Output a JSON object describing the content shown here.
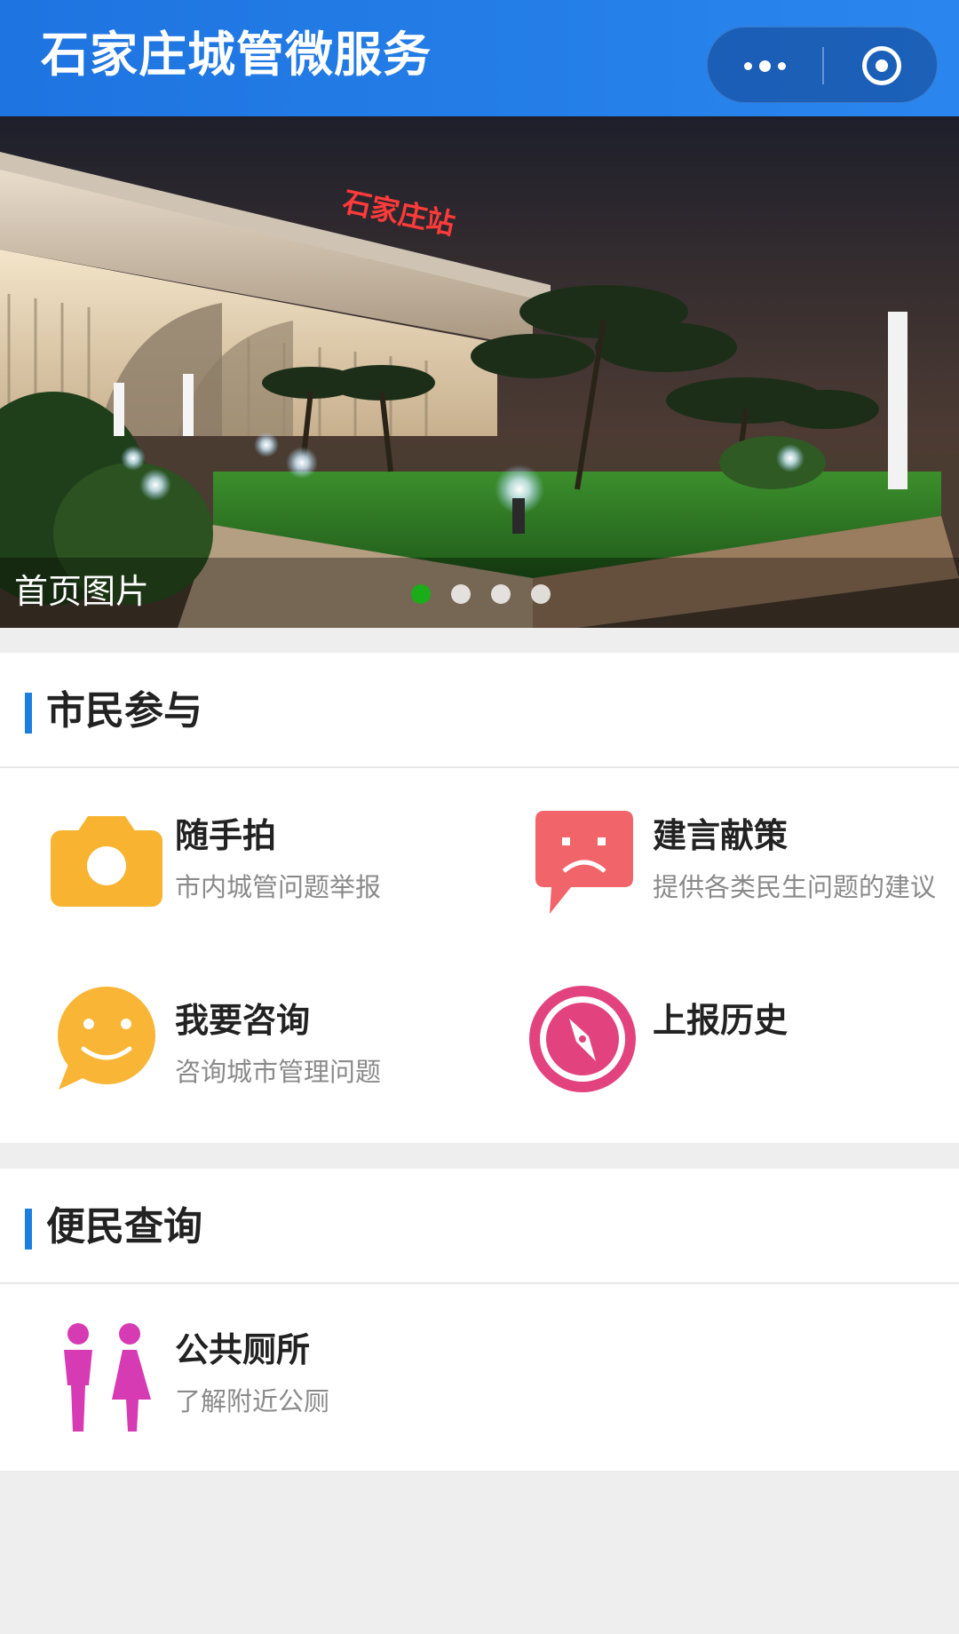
{
  "header": {
    "title": "石家庄城管微服务",
    "menu_icon": "more-dots-icon",
    "close_icon": "target-circle-icon"
  },
  "banner": {
    "caption": "首页图片",
    "sign_text": "石家庄站",
    "slide_count": 4,
    "active_slide": 1
  },
  "citizen": {
    "title": "市民参与",
    "items": [
      {
        "title": "随手拍",
        "desc": "市内城管问题举报",
        "icon": "camera-icon",
        "color": "#f8b431"
      },
      {
        "title": "建言献策",
        "desc": "提供各类民生问题的建议",
        "icon": "sad-chat-icon",
        "color": "#f0646a"
      },
      {
        "title": "我要咨询",
        "desc": "咨询城市管理问题",
        "icon": "smile-chat-icon",
        "color": "#f9b535"
      },
      {
        "title": "上报历史",
        "desc": "",
        "icon": "compass-icon",
        "color": "#e2437f"
      }
    ]
  },
  "convenience": {
    "title": "便民查询",
    "items": [
      {
        "title": "公共厕所",
        "desc": "了解附近公厕",
        "icon": "restroom-icon",
        "color": "#d63bb4"
      }
    ]
  },
  "colors": {
    "header": "#1e74e0",
    "accent_bar": "#1c7ee0",
    "active_dot": "#1aad19",
    "background": "#eeeeee"
  }
}
